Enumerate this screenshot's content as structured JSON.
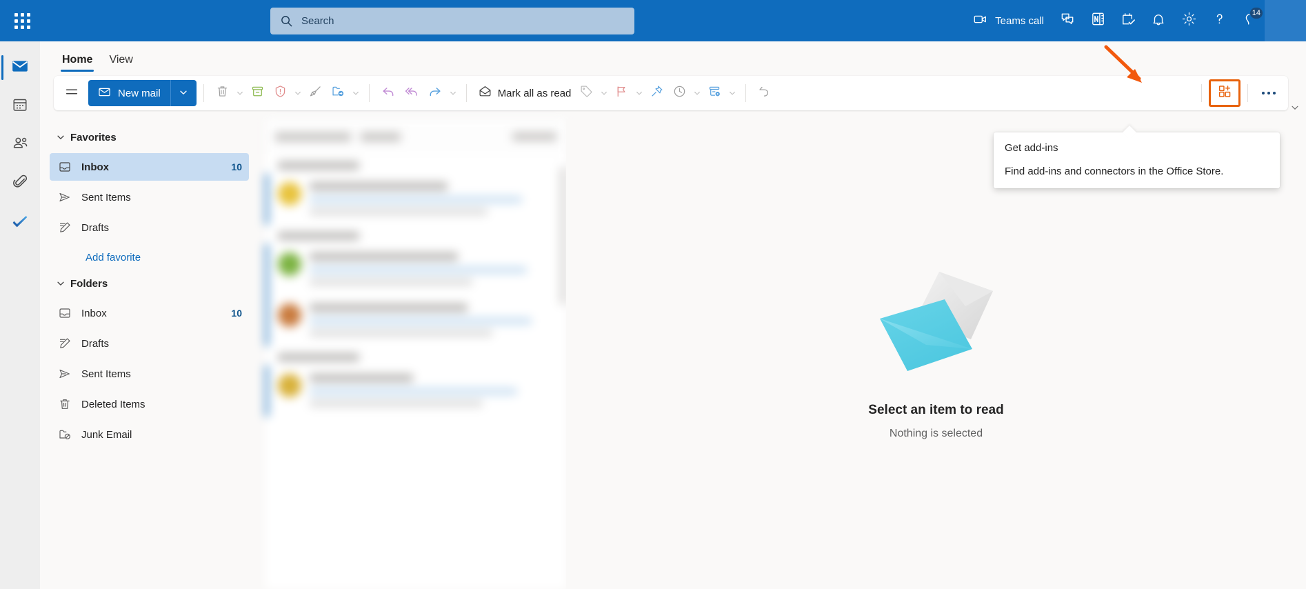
{
  "topbar": {
    "waffle_label": "App launcher",
    "search": {
      "placeholder": "Search",
      "value": ""
    },
    "teams_call_label": "Teams call",
    "icons": {
      "waffle": "app-launcher-icon",
      "search": "search-icon",
      "video": "video-camera-icon",
      "chat": "chat-icon",
      "note": "onenote-icon",
      "tasks": "tasks-checklist-icon",
      "bell": "notifications-bell-icon",
      "gear": "settings-gear-icon",
      "help": "help-question-icon",
      "diagnostics": "diagnostics-icon"
    },
    "notification_badge": "14",
    "accent_color": "#0f6cbd"
  },
  "rail": {
    "items": [
      {
        "name": "mail",
        "icon": "mail-icon",
        "active": true
      },
      {
        "name": "calendar",
        "icon": "calendar-icon",
        "active": false
      },
      {
        "name": "people",
        "icon": "people-icon",
        "active": false
      },
      {
        "name": "files",
        "icon": "paperclip-files-icon",
        "active": false
      },
      {
        "name": "todo",
        "icon": "todo-checkmark-icon",
        "active": false
      }
    ]
  },
  "tabs": [
    {
      "label": "Home",
      "active": true
    },
    {
      "label": "View",
      "active": false
    }
  ],
  "ribbon": {
    "hamburger_icon": "hamburger-menu-icon",
    "new_mail_label": "New mail",
    "new_mail_icon": "envelope-icon",
    "mark_all_read_label": "Mark all as read",
    "mark_all_read_icon": "open-envelope-icon",
    "more_label": "•••",
    "add_ins_icon": "add-ins-grid-plus-icon",
    "highlight_color": "#e8620c",
    "commands": [
      {
        "name": "delete",
        "icon": "trash-icon",
        "caret": true
      },
      {
        "name": "archive",
        "icon": "archive-icon",
        "caret": false
      },
      {
        "name": "report",
        "icon": "shield-alert-icon",
        "caret": true
      },
      {
        "name": "sweep",
        "icon": "broom-sweep-icon",
        "caret": false
      },
      {
        "name": "move-to",
        "icon": "move-to-folder-icon",
        "caret": true
      }
    ],
    "reply_commands": [
      {
        "name": "reply",
        "icon": "reply-arrow-icon",
        "caret": false
      },
      {
        "name": "reply-all",
        "icon": "reply-all-arrow-icon",
        "caret": false
      },
      {
        "name": "forward",
        "icon": "forward-arrow-icon",
        "caret": true
      }
    ],
    "tag_commands": [
      {
        "name": "categorize",
        "icon": "tag-icon",
        "caret": true
      },
      {
        "name": "flag",
        "icon": "flag-icon",
        "caret": true
      },
      {
        "name": "pin",
        "icon": "pin-icon",
        "caret": false
      },
      {
        "name": "snooze",
        "icon": "clock-icon",
        "caret": true
      },
      {
        "name": "rules",
        "icon": "rules-gear-icon",
        "caret": true
      }
    ],
    "undo_command": {
      "name": "undo",
      "icon": "undo-icon",
      "caret": false
    }
  },
  "callout": {
    "title": "Get add-ins",
    "body": "Find add-ins and connectors in the Office Store."
  },
  "folder_pane": {
    "groups": [
      {
        "name": "Favorites",
        "label": "Favorites",
        "expanded": true,
        "items": [
          {
            "label": "Inbox",
            "icon": "inbox-icon",
            "count": "10",
            "selected": true
          },
          {
            "label": "Sent Items",
            "icon": "sent-icon",
            "count": "",
            "selected": false
          },
          {
            "label": "Drafts",
            "icon": "drafts-pencil-icon",
            "count": "",
            "selected": false
          }
        ],
        "link": "Add favorite"
      },
      {
        "name": "Folders",
        "label": "Folders",
        "expanded": true,
        "items": [
          {
            "label": "Inbox",
            "icon": "inbox-icon",
            "count": "10",
            "selected": false
          },
          {
            "label": "Drafts",
            "icon": "drafts-pencil-icon",
            "count": "",
            "selected": false
          },
          {
            "label": "Sent Items",
            "icon": "sent-icon",
            "count": "",
            "selected": false
          },
          {
            "label": "Deleted Items",
            "icon": "trash-icon",
            "count": "",
            "selected": false
          },
          {
            "label": "Junk Email",
            "icon": "junk-folder-icon",
            "count": "",
            "selected": false
          }
        ],
        "link": ""
      }
    ]
  },
  "message_list": {
    "obscured": true,
    "avatar_colors": [
      "#e8c33c",
      "#7cb342",
      "#c97b3e",
      "#d8b13a"
    ]
  },
  "reading_pane": {
    "title": "Select an item to read",
    "subtitle": "Nothing is selected",
    "illustration": "empty-envelope-illustration"
  }
}
